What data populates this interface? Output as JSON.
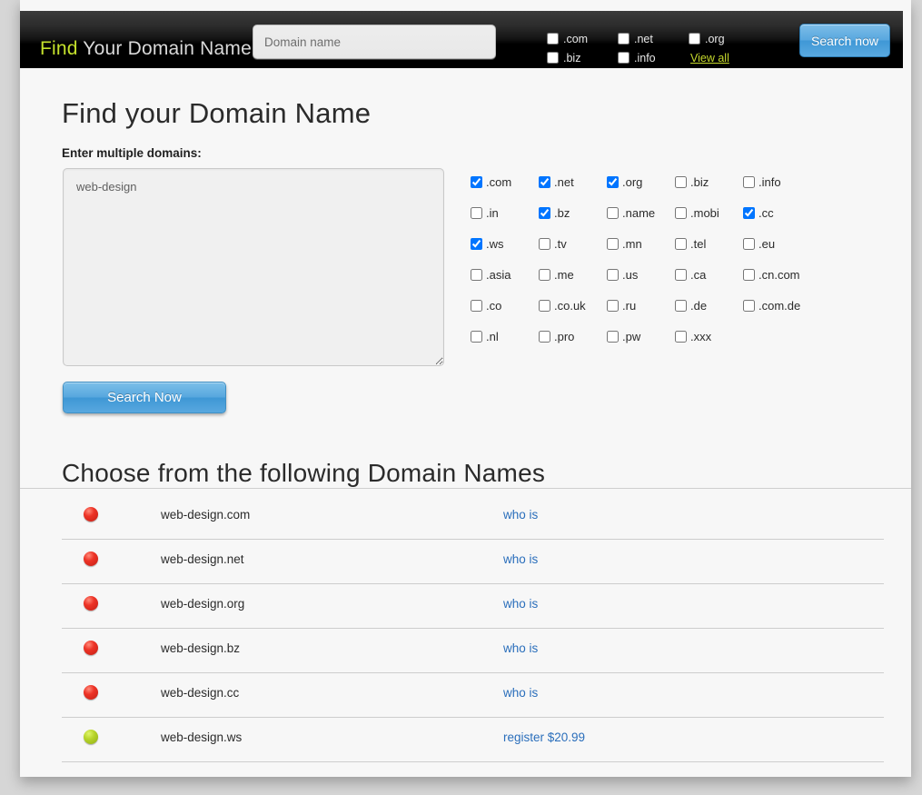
{
  "header": {
    "brand_accent": "Find",
    "brand_rest": " Your Domain Name",
    "domain_input_placeholder": "Domain name",
    "domain_input_value": "",
    "tlds": [
      {
        "label": ".com",
        "checked": false
      },
      {
        "label": ".net",
        "checked": false
      },
      {
        "label": ".org",
        "checked": false
      },
      {
        "label": ".biz",
        "checked": false
      },
      {
        "label": ".info",
        "checked": false
      }
    ],
    "view_all_label": "View all",
    "search_button_label": "Search now"
  },
  "main": {
    "title": "Find your Domain Name",
    "multi_label": "Enter multiple domains:",
    "textarea_value": "web-design",
    "textarea_placeholder": "",
    "search_button_label": "Search Now",
    "tld_grid": [
      [
        {
          "label": ".com",
          "checked": true
        },
        {
          "label": ".net",
          "checked": true
        },
        {
          "label": ".org",
          "checked": true
        },
        {
          "label": ".biz",
          "checked": false
        },
        {
          "label": ".info",
          "checked": false
        }
      ],
      [
        {
          "label": ".in",
          "checked": false
        },
        {
          "label": ".bz",
          "checked": true
        },
        {
          "label": ".name",
          "checked": false
        },
        {
          "label": ".mobi",
          "checked": false
        },
        {
          "label": ".cc",
          "checked": true
        }
      ],
      [
        {
          "label": ".ws",
          "checked": true
        },
        {
          "label": ".tv",
          "checked": false
        },
        {
          "label": ".mn",
          "checked": false
        },
        {
          "label": ".tel",
          "checked": false
        },
        {
          "label": ".eu",
          "checked": false
        }
      ],
      [
        {
          "label": ".asia",
          "checked": false
        },
        {
          "label": ".me",
          "checked": false
        },
        {
          "label": ".us",
          "checked": false
        },
        {
          "label": ".ca",
          "checked": false
        },
        {
          "label": ".cn.com",
          "checked": false
        }
      ],
      [
        {
          "label": ".co",
          "checked": false
        },
        {
          "label": ".co.uk",
          "checked": false
        },
        {
          "label": ".ru",
          "checked": false
        },
        {
          "label": ".de",
          "checked": false
        },
        {
          "label": ".com.de",
          "checked": false
        }
      ],
      [
        {
          "label": ".nl",
          "checked": false
        },
        {
          "label": ".pro",
          "checked": false
        },
        {
          "label": ".pw",
          "checked": false
        },
        {
          "label": ".xxx",
          "checked": false
        }
      ]
    ]
  },
  "results": {
    "title": "Choose from the following Domain Names",
    "rows": [
      {
        "status": "taken",
        "domain": "web-design.com",
        "action": "who is"
      },
      {
        "status": "taken",
        "domain": "web-design.net",
        "action": "who is"
      },
      {
        "status": "taken",
        "domain": "web-design.org",
        "action": "who is"
      },
      {
        "status": "taken",
        "domain": "web-design.bz",
        "action": "who is"
      },
      {
        "status": "taken",
        "domain": "web-design.cc",
        "action": "who is"
      },
      {
        "status": "available",
        "domain": "web-design.ws",
        "action": "register $20.99"
      }
    ]
  },
  "colors": {
    "accent_green": "#c4e02c",
    "link_blue": "#2a6ebb",
    "button_blue": "#3f98d6",
    "taken_red": "#ed3326",
    "available_green": "#b7d42a"
  }
}
